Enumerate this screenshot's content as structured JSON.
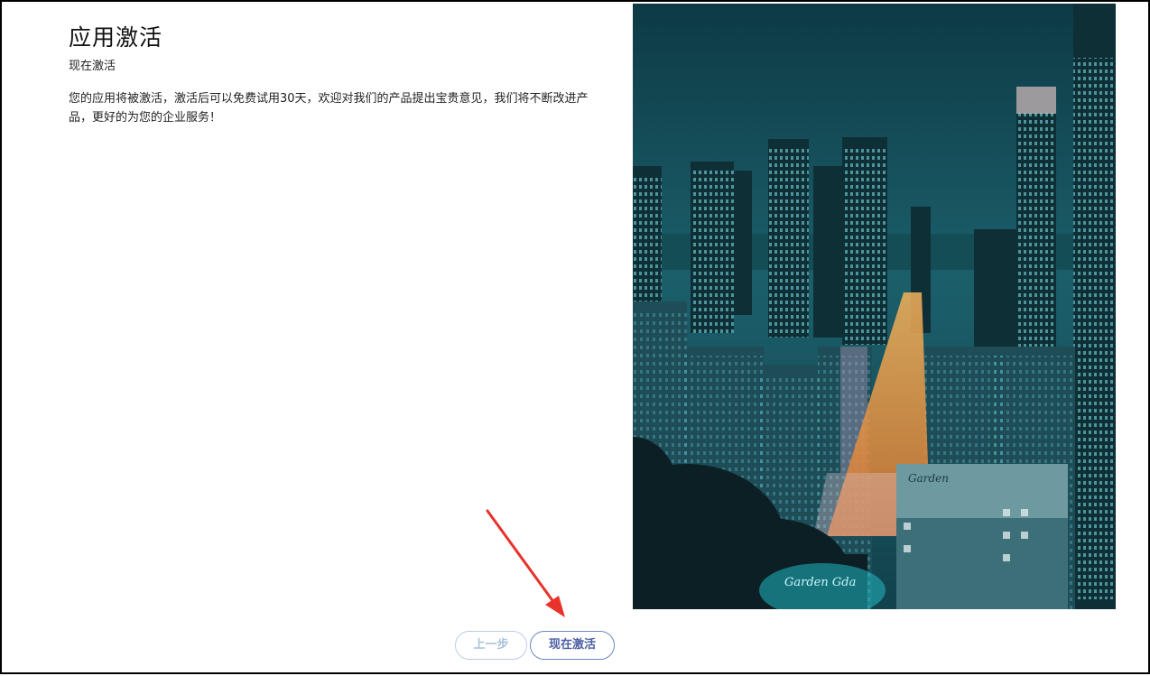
{
  "page": {
    "title": "应用激活",
    "subtitle": "现在激活",
    "description": "您的应用将被激活，激活后可以免费试用30天，欢迎对我们的产品提出宝贵意见，我们将不断改进产品，更好的为您的企业服务！"
  },
  "photo": {
    "sign_text_1": "Garden",
    "sign_text_2": "Garden Gda"
  },
  "buttons": {
    "prev_label": "上一步",
    "activate_label": "现在激活"
  },
  "colors": {
    "annotation_arrow": "#e8322b",
    "activate_border": "#6f86c4",
    "prev_border": "#b9cfe6"
  }
}
